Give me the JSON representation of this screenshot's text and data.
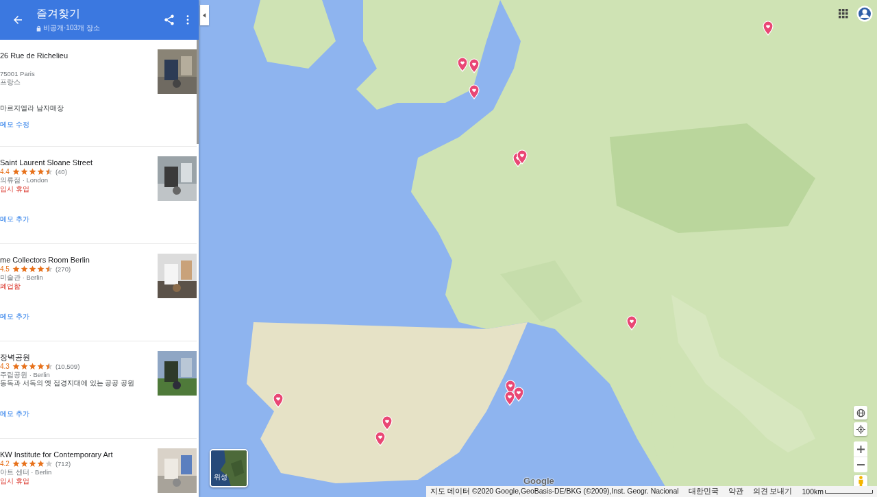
{
  "header": {
    "title": "즐겨찾기",
    "subtitle": "비공개·103개 장소"
  },
  "places": [
    {
      "name": "26 Rue de Richelieu",
      "address_lines": [
        "75001 Paris",
        "프랑스"
      ],
      "description": "마르지엘라 남자매장",
      "memo_link": "메모 수정"
    },
    {
      "name": "Saint Laurent Sloane Street",
      "rating": "4.4",
      "stars": 4.5,
      "reviews": "(40)",
      "category": "의류점 · London",
      "status": "임시 휴업",
      "memo_link": "메모 추가"
    },
    {
      "name": "me Collectors Room Berlin",
      "rating": "4.5",
      "stars": 4.5,
      "reviews": "(270)",
      "category": "미술관 · Berlin",
      "status": "폐업함",
      "memo_link": "메모 추가"
    },
    {
      "name": "장벽공원",
      "rating": "4.3",
      "stars": 4.5,
      "reviews": "(10,509)",
      "category": "주립공원 · Berlin",
      "description": "동독과 서독의 옛 접경지대에 있는 공공 공원",
      "memo_link": "메모 추가"
    },
    {
      "name": "KW Institute for Contemporary Art",
      "rating": "4.2",
      "stars": 4,
      "reviews": "(712)",
      "category": "아트 센터 · Berlin",
      "status": "임시 휴업"
    }
  ],
  "map": {
    "layer_button": "위성",
    "logo": "Google",
    "attribution": [
      "지도 데이터 ©2020 Google,GeoBasis-DE/BKG (©2009),Inst. Geogr. Nacional",
      "대한민국",
      "약관",
      "의견 보내기"
    ],
    "scale": "100km"
  }
}
